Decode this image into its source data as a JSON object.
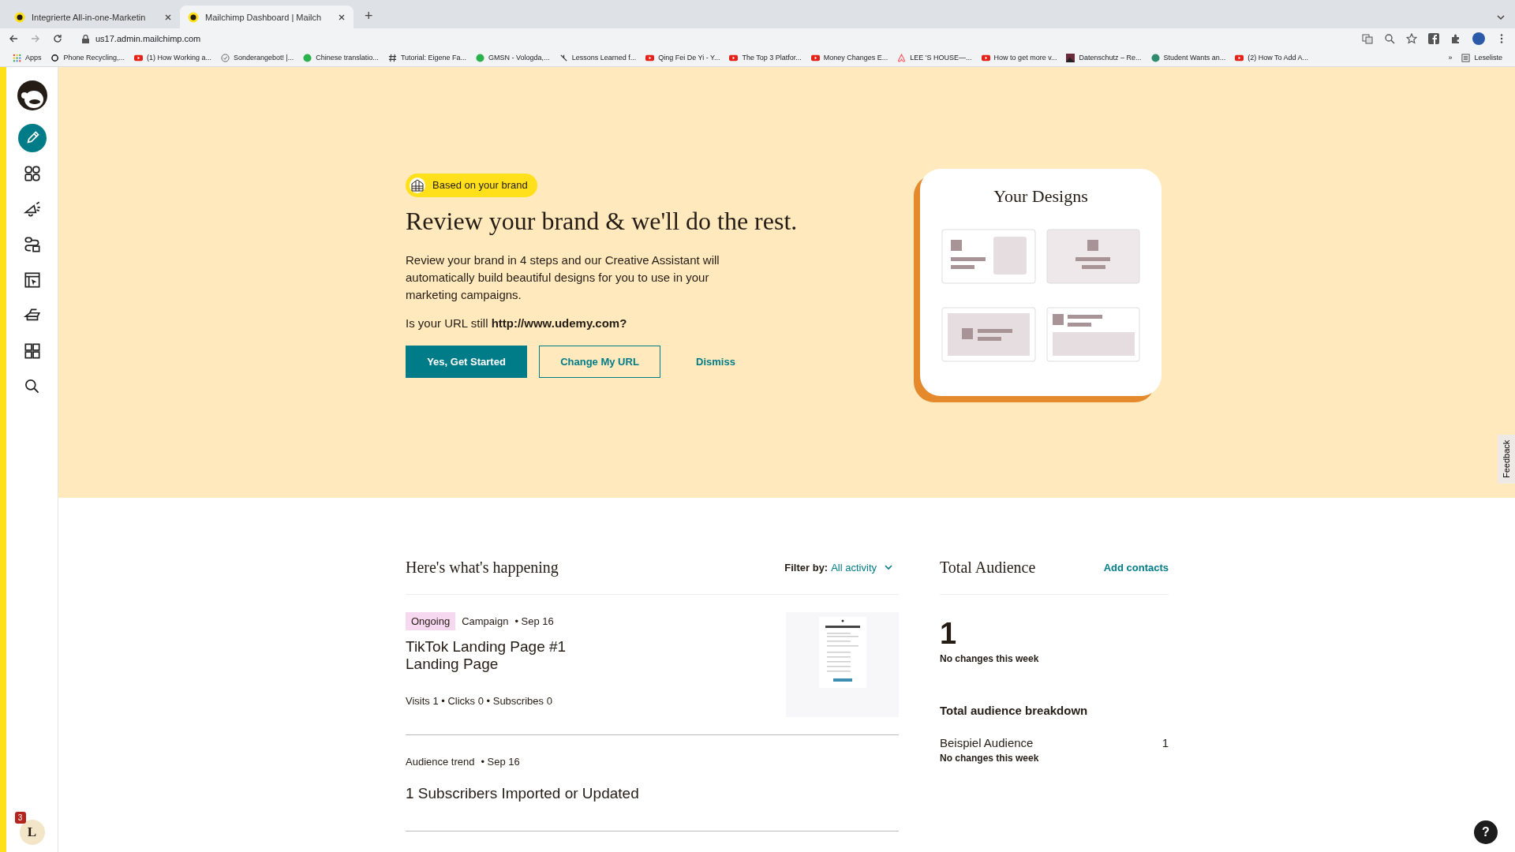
{
  "browser": {
    "tabs": [
      {
        "title": "Integrierte All-in-one-Marketin",
        "selected": false
      },
      {
        "title": "Mailchimp Dashboard | Mailch",
        "selected": true
      }
    ],
    "new_tab": "+",
    "url": "us17.admin.mailchimp.com",
    "bookmarks": [
      {
        "label": "Apps",
        "kind": "apps"
      },
      {
        "label": "Phone Recycling,...",
        "kind": "o2"
      },
      {
        "label": "(1) How Working a...",
        "kind": "video"
      },
      {
        "label": "Sonderangebot! |...",
        "kind": "check"
      },
      {
        "label": "Chinese translatio...",
        "kind": "green"
      },
      {
        "label": "Tutorial: Eigene Fa...",
        "kind": "hash"
      },
      {
        "label": "GMSN - Vologda,...",
        "kind": "green"
      },
      {
        "label": "Lessons Learned f...",
        "kind": "fork"
      },
      {
        "label": "Qing Fei De Yi - Y...",
        "kind": "video"
      },
      {
        "label": "The Top 3 Platfor...",
        "kind": "video"
      },
      {
        "label": "Money Changes E...",
        "kind": "video"
      },
      {
        "label": "LEE 'S HOUSE—...",
        "kind": "airbnb"
      },
      {
        "label": "How to get more v...",
        "kind": "video"
      },
      {
        "label": "Datenschutz – Re...",
        "kind": "image"
      },
      {
        "label": "Student Wants an...",
        "kind": "teal"
      },
      {
        "label": "(2) How To Add A...",
        "kind": "video"
      }
    ],
    "overflow": "»",
    "reading_list": "Leseliste"
  },
  "sidebar": {
    "items": [
      {
        "kind": "create",
        "selected": true
      },
      {
        "kind": "audience",
        "selected": false
      },
      {
        "kind": "campaigns",
        "selected": false
      },
      {
        "kind": "automations",
        "selected": false
      },
      {
        "kind": "website",
        "selected": false
      },
      {
        "kind": "content",
        "selected": false
      },
      {
        "kind": "integrations",
        "selected": false
      },
      {
        "kind": "search",
        "selected": false
      }
    ],
    "avatar": {
      "initial": "L",
      "badge": "3"
    }
  },
  "hero": {
    "badge": "Based on your brand",
    "title": "Review your brand & we'll do the rest.",
    "body": "Review your brand in 4 steps and our Creative Assistant will automatically build beautiful designs for you to use in your marketing campaigns.",
    "url_prompt": "Is your URL still **http://www.udemy.com?**",
    "buttons": [
      {
        "label": "Yes, Get Started",
        "kind": "primary"
      },
      {
        "label": "Change My URL",
        "kind": "secondary"
      },
      {
        "label": "Dismiss",
        "kind": "link"
      }
    ],
    "card_title": "Your Designs"
  },
  "activity": {
    "title": "Here's what's happening",
    "filter_label": "Filter by:",
    "filter_value": "All activity",
    "items": [
      {
        "kind": "campaign",
        "status": "Ongoing",
        "type": "Campaign",
        "date": "• Sep 16",
        "title": [
          "TikTok Landing Page #1",
          "Landing Page"
        ],
        "stats": "Visits 1 • Clicks 0 • Subscribes 0"
      },
      {
        "kind": "trend",
        "type": "Audience trend",
        "date": "• Sep 16",
        "title": [
          "1 Subscribers Imported or Updated"
        ]
      }
    ]
  },
  "audience": {
    "title": "Total Audience",
    "action": "Add contacts",
    "count": "1",
    "count_note": "No changes this week",
    "breakdown_title": "Total audience breakdown",
    "rows": [
      {
        "name": "Beispiel Audience",
        "count": "1",
        "note": "No changes this week"
      }
    ]
  },
  "feedback": "Feedback",
  "help": "?"
}
